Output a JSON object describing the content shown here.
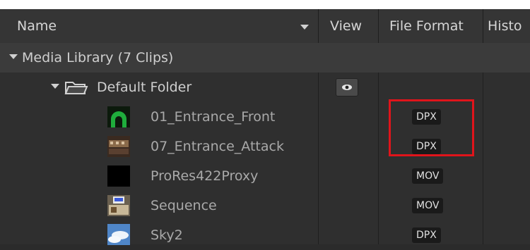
{
  "columns": {
    "name": "Name",
    "view": "View",
    "file_format": "File Format",
    "history": "Histo"
  },
  "library": {
    "label": "Media Library (7 Clips)"
  },
  "folder": {
    "label": "Default Folder"
  },
  "clips": [
    {
      "name": "01_Entrance_Front",
      "format": "DPX"
    },
    {
      "name": "07_Entrance_Attack",
      "format": "DPX"
    },
    {
      "name": "ProRes422Proxy",
      "format": "MOV"
    },
    {
      "name": "Sequence",
      "format": "MOV"
    },
    {
      "name": "Sky2",
      "format": "DPX"
    }
  ],
  "colors": {
    "highlight": "#e0141b",
    "background": "#2f2f2f"
  }
}
